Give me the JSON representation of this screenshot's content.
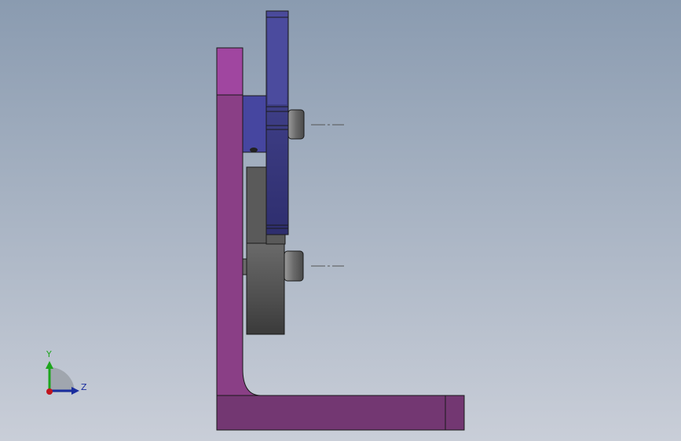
{
  "viewport": {
    "background_top": "#8a9bb0",
    "background_bottom": "#c7ccd6"
  },
  "colors": {
    "bracket_purple": "#8a3f86",
    "bracket_purple_light": "#a046a0",
    "bracket_purple_dark": "#6f3270",
    "gear_blue": "#3a3a86",
    "gear_blue_light": "#5656a6",
    "hub_blue": "#4a4a9a",
    "gray_part": "#595959",
    "gray_part_light": "#8a8a8a",
    "gray_dark": "#3e3e3e",
    "edge": "#1a1a1a"
  },
  "triad": {
    "y_label": "Y",
    "z_label": "Z",
    "y_color": "#1ea51e",
    "z_color": "#1a2d9e",
    "origin_color": "#c0141e"
  }
}
